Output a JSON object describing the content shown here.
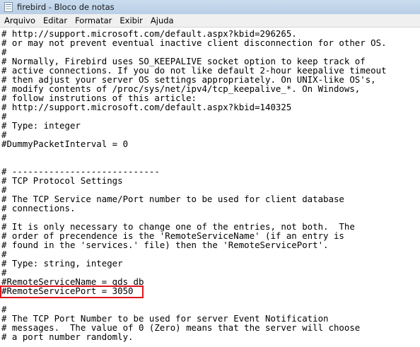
{
  "window": {
    "title": "firebird - Bloco de notas"
  },
  "menu": [
    {
      "label": "Arquivo",
      "name": "menu-arquivo"
    },
    {
      "label": "Editar",
      "name": "menu-editar"
    },
    {
      "label": "Formatar",
      "name": "menu-formatar"
    },
    {
      "label": "Exibir",
      "name": "menu-exibir"
    },
    {
      "label": "Ajuda",
      "name": "menu-ajuda"
    }
  ],
  "editor": {
    "lines": [
      "# http://support.microsoft.com/default.aspx?kbid=296265.",
      "# or may not prevent eventual inactive client disconnection for other OS.",
      "#",
      "# Normally, Firebird uses SO_KEEPALIVE socket option to keep track of",
      "# active connections. If you do not like default 2-hour keepalive timeout",
      "# then adjust your server OS settings appropriately. On UNIX-like OS's,",
      "# modify contents of /proc/sys/net/ipv4/tcp_keepalive_*. On Windows,",
      "# follow instrutions of this article:",
      "# http://support.microsoft.com/default.aspx?kbid=140325",
      "#",
      "# Type: integer",
      "#",
      "#DummyPacketInterval = 0",
      "",
      "",
      "# ----------------------------",
      "# TCP Protocol Settings",
      "#",
      "# The TCP Service name/Port number to be used for client database",
      "# connections.",
      "#",
      "# It is only necessary to change one of the entries, not both.  The",
      "# order of precendence is the 'RemoteServiceName' (if an entry is",
      "# found in the 'services.' file) then the 'RemoteServicePort'.",
      "#",
      "# Type: string, integer",
      "#",
      "#RemoteServiceName = gds_db",
      "#RemoteServicePort = 3050",
      "",
      "#",
      "# The TCP Port Number to be used for server Event Notification",
      "# messages.  The value of 0 (Zero) means that the server will choose",
      "# a port number randomly."
    ],
    "highlighted_line": "#RemoteServicePort = 3050",
    "highlight_color": "#e0141e"
  }
}
